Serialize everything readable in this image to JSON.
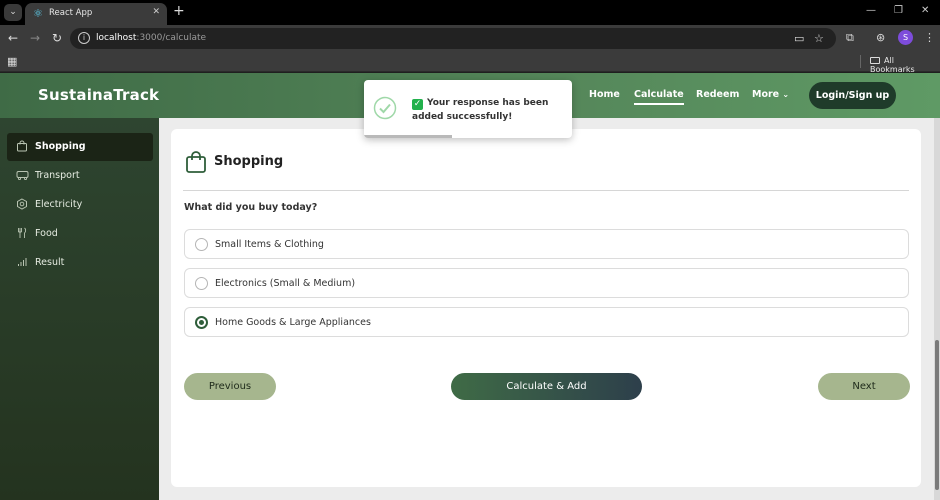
{
  "browser": {
    "tab_title": "React App",
    "url_host": "localhost",
    "url_path": ":3000/calculate",
    "bookmarks_label": "All Bookmarks",
    "profile_initial": "S"
  },
  "header": {
    "brand": "SustainaTrack",
    "nav": [
      {
        "label": "Home"
      },
      {
        "label": "Calculate",
        "active": true
      },
      {
        "label": "Redeem"
      },
      {
        "label": "More"
      }
    ],
    "login_label": "Login/Sign up"
  },
  "toast": {
    "message": "Your response has been added successfully!"
  },
  "sidebar": {
    "items": [
      {
        "label": "Shopping",
        "icon": "shopping-bag-icon",
        "active": true
      },
      {
        "label": "Transport",
        "icon": "bus-icon"
      },
      {
        "label": "Electricity",
        "icon": "bolt-icon"
      },
      {
        "label": "Food",
        "icon": "cutlery-icon"
      },
      {
        "label": "Result",
        "icon": "bar-chart-icon"
      }
    ]
  },
  "card": {
    "title": "Shopping",
    "question": "What did you buy today?",
    "options": [
      {
        "label": "Small Items & Clothing",
        "selected": false
      },
      {
        "label": "Electronics (Small & Medium)",
        "selected": false
      },
      {
        "label": "Home Goods & Large Appliances",
        "selected": true
      }
    ],
    "prev_label": "Previous",
    "calc_label": "Calculate & Add",
    "next_label": "Next"
  },
  "colors": {
    "accent": "#3f6b46",
    "sidebar_bg": "#2e4530",
    "secondary_button": "#a6b68e",
    "success": "#22b14c"
  }
}
